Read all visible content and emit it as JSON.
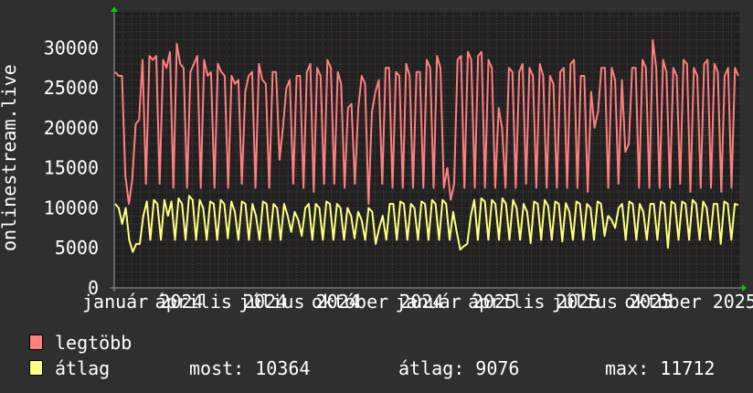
{
  "chart_data": {
    "type": "line",
    "ylabel": "onlinestream.live",
    "xlabel": "",
    "ylim": [
      0,
      34500
    ],
    "yticks": [
      "0",
      "5000",
      "10000",
      "15000",
      "20000",
      "25000",
      "30000"
    ],
    "xtick_labels": [
      "január 2024",
      "április 2024",
      "július 2024",
      "október 2024",
      "január 2025",
      "április 2025",
      "július 2025",
      "október 2025"
    ],
    "x_range": [
      "2024-01",
      "2025-12"
    ],
    "grid": true,
    "legend_position": "bottom-left",
    "series": [
      {
        "name": "legtöbb",
        "color": "#ff7f7f",
        "values": [
          27000,
          26500,
          26500,
          14000,
          10500,
          13500,
          20500,
          21000,
          28500,
          13000,
          29000,
          28500,
          29000,
          13000,
          28500,
          27500,
          29500,
          12500,
          30500,
          28000,
          27500,
          12500,
          27000,
          28000,
          29000,
          12500,
          28500,
          26500,
          27000,
          12500,
          28000,
          27000,
          26500,
          12500,
          26500,
          25500,
          26000,
          13000,
          24500,
          26500,
          27000,
          12500,
          28000,
          26000,
          25500,
          12500,
          27000,
          27000,
          16000,
          20000,
          25000,
          26000,
          13000,
          26500,
          26500,
          12500,
          27000,
          28000,
          12000,
          27500,
          26500,
          13000,
          28500,
          27500,
          13000,
          27000,
          25500,
          12500,
          22500,
          23000,
          13000,
          22500,
          26500,
          25500,
          10500,
          22000,
          24500,
          26000,
          13000,
          27500,
          27500,
          12500,
          27000,
          26500,
          12500,
          28000,
          26500,
          12500,
          27000,
          27000,
          12500,
          28500,
          27500,
          12500,
          29000,
          27500,
          12500,
          15000,
          11000,
          13000,
          28500,
          29000,
          12500,
          29500,
          28500,
          12500,
          29000,
          29500,
          12500,
          28500,
          27500,
          12500,
          22500,
          20000,
          12500,
          27500,
          27000,
          12500,
          27000,
          28000,
          13000,
          27500,
          26500,
          12500,
          28000,
          26500,
          12500,
          26500,
          25500,
          12500,
          27000,
          27500,
          12500,
          28000,
          28500,
          12500,
          26500,
          26500,
          12000,
          24500,
          20000,
          22000,
          27500,
          27500,
          12500,
          27500,
          26000,
          13000,
          26000,
          17000,
          18000,
          27500,
          27500,
          12500,
          28500,
          27500,
          12500,
          31000,
          27500,
          12500,
          28500,
          27000,
          12500,
          27500,
          26500,
          13000,
          28500,
          28000,
          12000,
          27500,
          26500,
          12500,
          28000,
          28500,
          12500,
          28000,
          27000,
          12000,
          26500,
          27500,
          12500,
          27500,
          26500
        ]
      },
      {
        "name": "átlag",
        "color": "#ffff80",
        "values": [
          10500,
          10000,
          8000,
          10000,
          6000,
          4500,
          5500,
          5500,
          9000,
          10800,
          6000,
          11000,
          10500,
          6000,
          11000,
          9000,
          10800,
          6000,
          11200,
          10500,
          6000,
          11500,
          11000,
          6000,
          11000,
          10000,
          6000,
          10800,
          10500,
          6000,
          11000,
          10500,
          6200,
          10800,
          9500,
          6000,
          10800,
          10500,
          6000,
          10500,
          9000,
          6000,
          10800,
          10500,
          6000,
          10500,
          10000,
          6000,
          10500,
          9000,
          7000,
          9500,
          8500,
          6500,
          10000,
          10500,
          6000,
          10500,
          10000,
          6000,
          10800,
          10500,
          6000,
          10500,
          10000,
          6000,
          10000,
          9000,
          6200,
          9500,
          8500,
          6000,
          10000,
          9500,
          5500,
          7500,
          9000,
          6000,
          10500,
          10500,
          6000,
          10800,
          10500,
          6000,
          10500,
          10000,
          6000,
          10800,
          10500,
          6000,
          11000,
          10500,
          6000,
          11000,
          10500,
          6000,
          9500,
          7000,
          4800,
          5200,
          5500,
          9000,
          11000,
          6000,
          11200,
          10800,
          6000,
          11000,
          10500,
          6000,
          11200,
          10500,
          6000,
          11000,
          10000,
          6000,
          10500,
          9500,
          5600,
          10800,
          10500,
          6000,
          11000,
          10200,
          6000,
          10800,
          10500,
          5800,
          10600,
          9500,
          6000,
          10800,
          10500,
          6000,
          10500,
          10000,
          6000,
          10800,
          10500,
          6500,
          9000,
          8500,
          7500,
          10000,
          10500,
          6000,
          10800,
          10500,
          6000,
          10500,
          9500,
          6000,
          10500,
          10500,
          6000,
          10800,
          10500,
          5000,
          10800,
          10500,
          6000,
          10800,
          10500,
          6000,
          11000,
          10500,
          6000,
          10800,
          10000,
          6000,
          10500,
          10500,
          5500,
          10800,
          10500,
          6000,
          10500,
          10364
        ]
      }
    ]
  },
  "legend": {
    "items": [
      {
        "label": "legtöbb",
        "color": "#ff7f7f"
      },
      {
        "label": "átlag",
        "color": "#ffff80"
      }
    ],
    "stats": {
      "now": "most: 10364",
      "avg": "átlag: 9076",
      "max": "max: 11712"
    }
  }
}
